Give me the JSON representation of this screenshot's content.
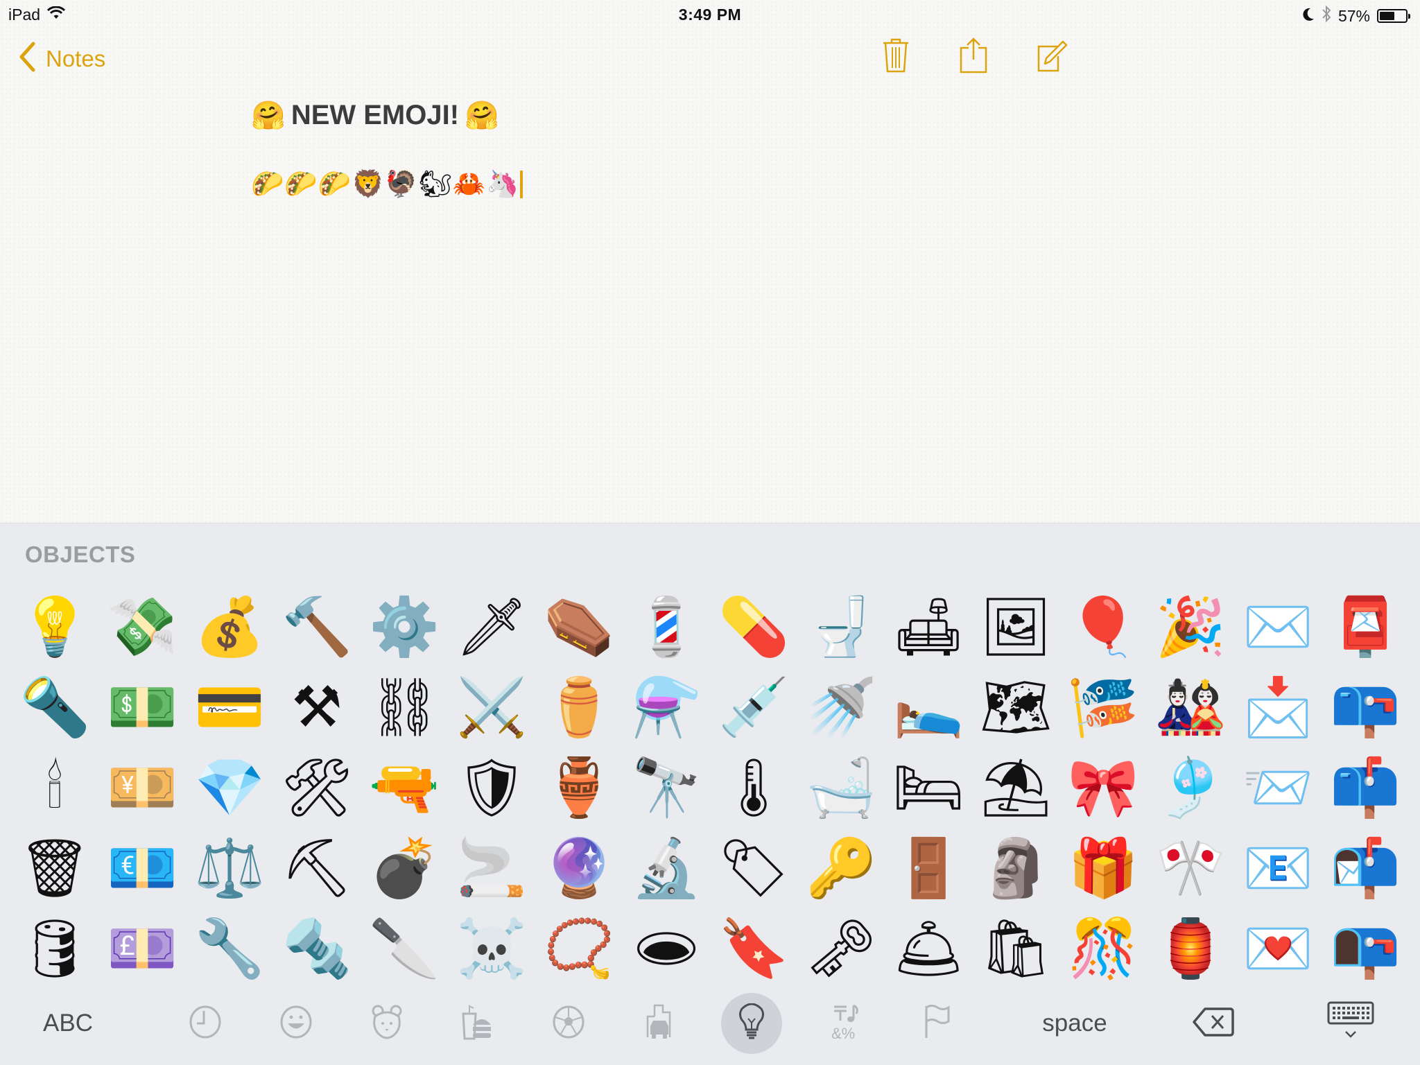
{
  "status_bar": {
    "device": "iPad",
    "wifi_icon": "wifi-icon",
    "time": "3:49 PM",
    "do_not_disturb_icon": "moon-icon",
    "bluetooth_icon": "bluetooth-icon",
    "battery_percent": "57%",
    "battery_level": 0.57
  },
  "nav": {
    "back_label": "Notes",
    "back_icon": "chevron-left-icon",
    "actions": [
      {
        "name": "trash",
        "icon": "trash-icon"
      },
      {
        "name": "share",
        "icon": "share-icon"
      },
      {
        "name": "compose",
        "icon": "compose-icon"
      }
    ],
    "accent_color": "#dba40e"
  },
  "note": {
    "title_emoji_left": "🤗",
    "title_text": "NEW EMOJI!",
    "title_emoji_right": "🤗",
    "body_line": "🌮🌮🌮🦁🦃🐿🦀🦄"
  },
  "keyboard": {
    "section_label": "OBJECTS",
    "emoji_rows": [
      [
        "💡",
        "💸",
        "💰",
        "🔨",
        "⚙️",
        "🗡",
        "⚰️",
        "💈",
        "💊",
        "🚽",
        "🛋",
        "🖼",
        "🎈",
        "🎉",
        "✉️",
        "📮"
      ],
      [
        "🔦",
        "💵",
        "💳",
        "⚒",
        "⛓",
        "⚔️",
        "⚱️",
        "⚗️",
        "💉",
        "🚿",
        "🛌",
        "🗺",
        "🎏",
        "🎎",
        "📩",
        "📪"
      ],
      [
        "🕯",
        "💴",
        "💎",
        "🛠",
        "🔫",
        "🛡",
        "🏺",
        "🔭",
        "🌡",
        "🛁",
        "🛏",
        "⛱",
        "🎀",
        "🎐",
        "📨",
        "📫"
      ],
      [
        "🗑",
        "💶",
        "⚖️",
        "⛏",
        "💣",
        "🚬",
        "🔮",
        "🔬",
        "🏷",
        "🔑",
        "🚪",
        "🗿",
        "🎁",
        "🎌",
        "📧",
        "📬"
      ],
      [
        "🛢",
        "💷",
        "🔧",
        "🔩",
        "🔪",
        "☠️",
        "📿",
        "🕳",
        "🔖",
        "🗝",
        "🛎",
        "🛍",
        "🎊",
        "🏮",
        "💌",
        "📭"
      ]
    ],
    "bottom_bar": {
      "abc_label": "ABC",
      "categories": [
        {
          "name": "recent",
          "icon": "clock-icon",
          "active": false
        },
        {
          "name": "smileys",
          "icon": "smiley-icon",
          "active": false
        },
        {
          "name": "animals",
          "icon": "bear-icon",
          "active": false
        },
        {
          "name": "food",
          "icon": "burger-icon",
          "active": false
        },
        {
          "name": "activity",
          "icon": "soccer-ball-icon",
          "active": false
        },
        {
          "name": "travel",
          "icon": "car-building-icon",
          "active": false
        },
        {
          "name": "objects",
          "icon": "lightbulb-icon",
          "active": true
        },
        {
          "name": "symbols",
          "icon": "symbols-icon",
          "active": false
        },
        {
          "name": "flags",
          "icon": "flag-icon",
          "active": false
        }
      ],
      "space_label": "space",
      "delete_icon": "backspace-icon",
      "dismiss_icon": "keyboard-dismiss-icon"
    }
  }
}
